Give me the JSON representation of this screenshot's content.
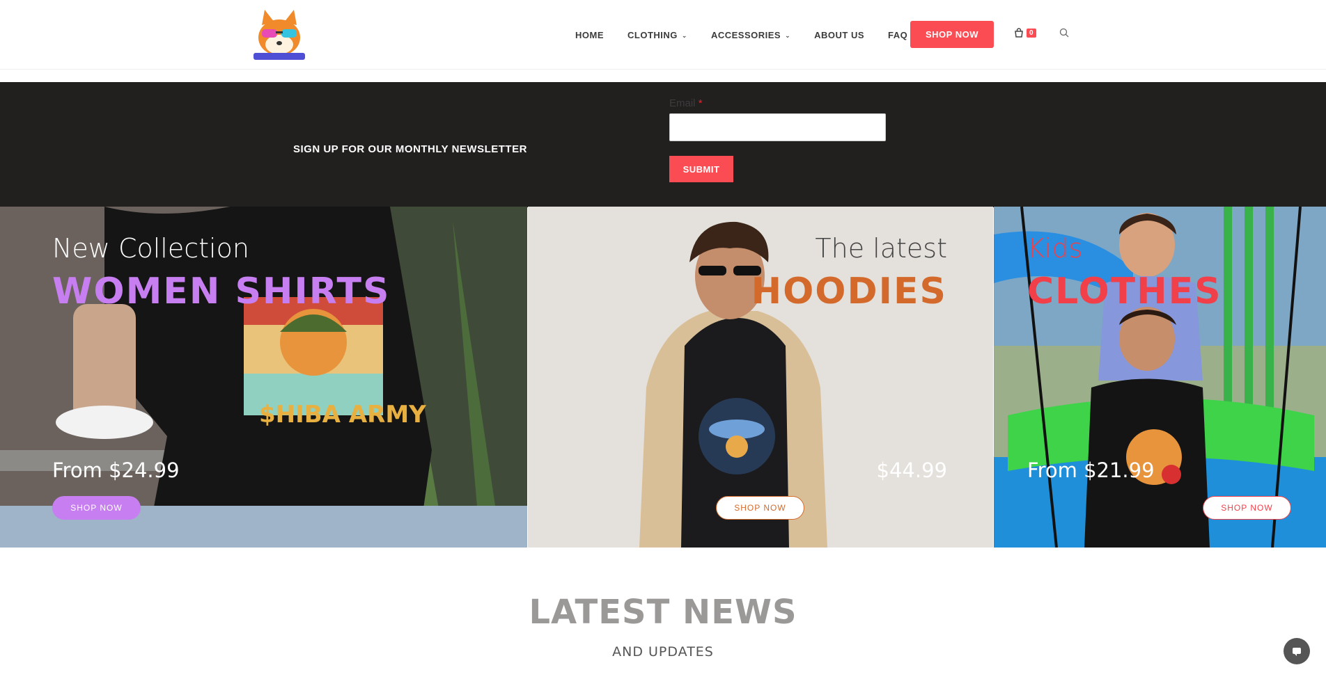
{
  "header": {
    "logo_alt": "Shiba Inu logo",
    "nav": [
      {
        "label": "HOME",
        "has_dropdown": false
      },
      {
        "label": "CLOTHING",
        "has_dropdown": true
      },
      {
        "label": "ACCESSORIES",
        "has_dropdown": true
      },
      {
        "label": "ABOUT US",
        "has_dropdown": false
      },
      {
        "label": "FAQ",
        "has_dropdown": false
      }
    ],
    "shop_now": "SHOP NOW",
    "cart_count": "0"
  },
  "newsletter": {
    "title": "SIGN UP FOR OUR MONTHLY NEWSLETTER",
    "email_label": "Email",
    "required_mark": "*",
    "email_value": "",
    "submit": "SUBMIT"
  },
  "promos": [
    {
      "subtitle": "New Collection",
      "title": "WOMEN SHIRTS",
      "price": "From $24.99",
      "button": "SHOP NOW",
      "accent": "#c77ef0"
    },
    {
      "subtitle": "The latest",
      "title": "HOODIES",
      "price": "$44.99",
      "button": "SHOP NOW",
      "accent": "#d36a2c"
    },
    {
      "subtitle": "Kids",
      "title": "CLOTHES",
      "price": "From $21.99",
      "button": "SHOP NOW",
      "accent": "#f1404a"
    }
  ],
  "news": {
    "title": "LATEST NEWS",
    "subtitle": "AND UPDATES"
  },
  "colors": {
    "brand_red": "#fb4c53",
    "dark_band": "#221f1f"
  }
}
